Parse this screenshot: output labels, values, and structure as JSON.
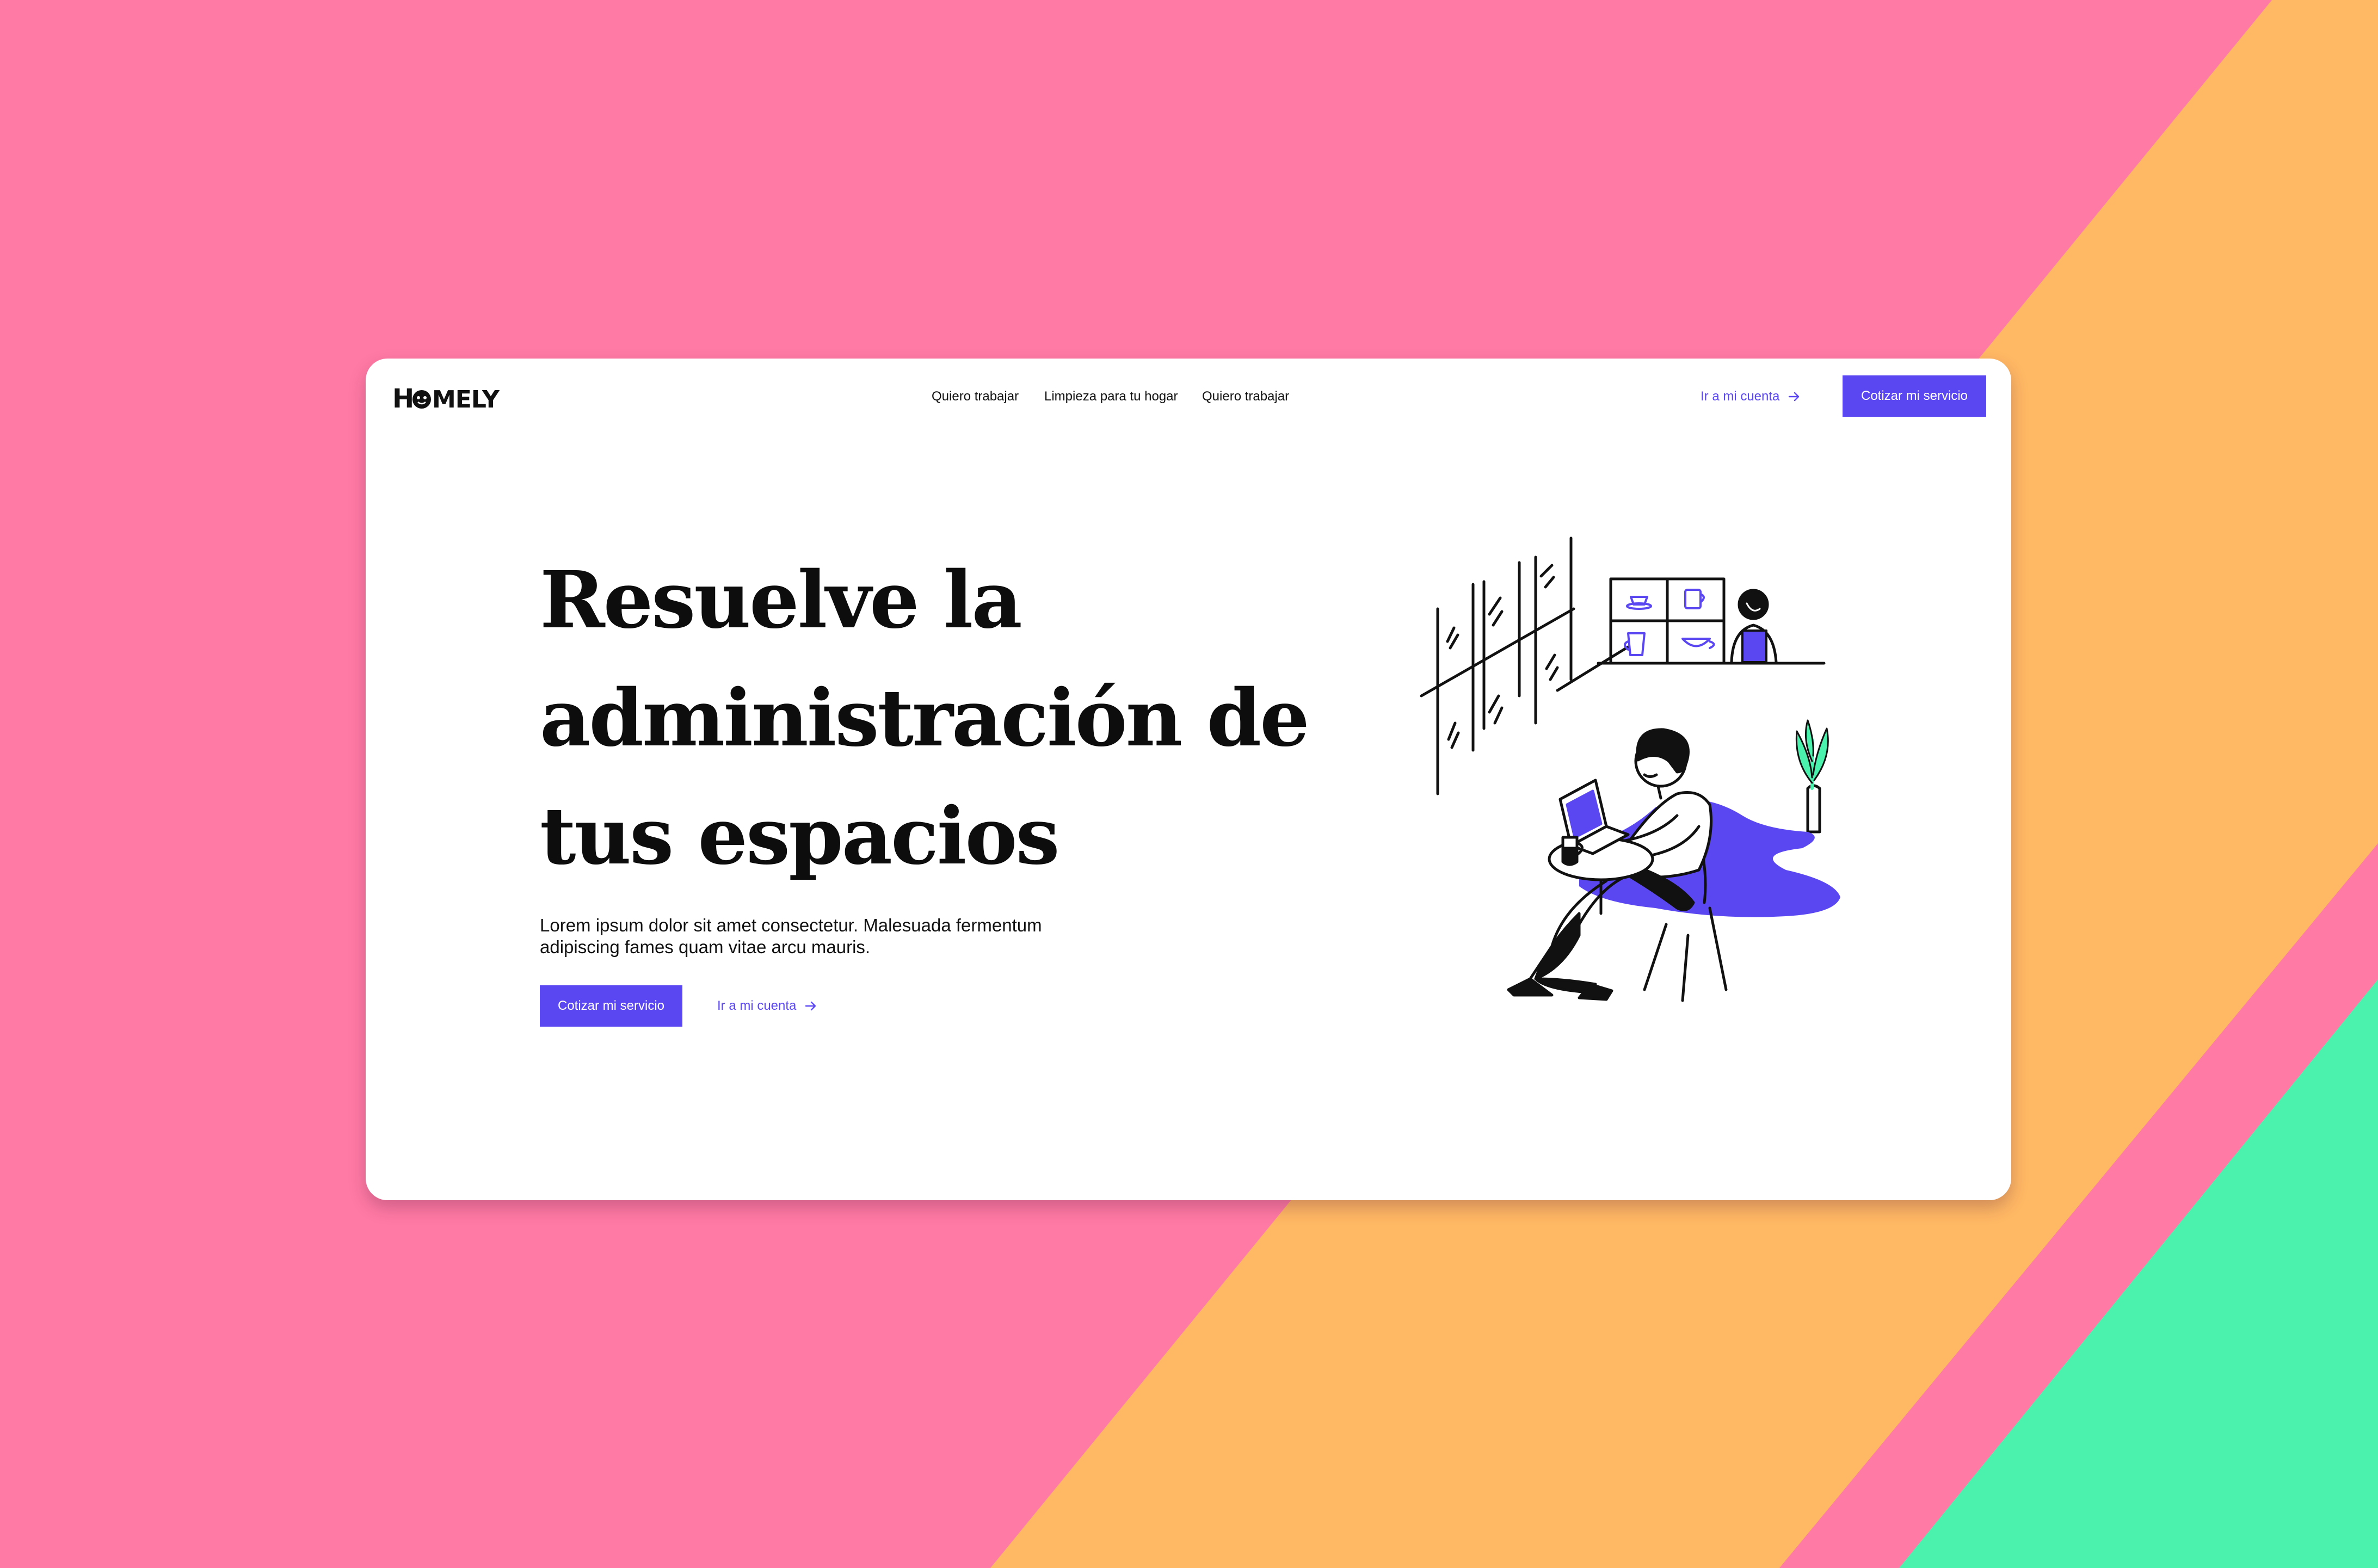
{
  "colors": {
    "pink": "#ff7aa5",
    "orange": "#ffb864",
    "green": "#4bf2ad",
    "accent": "#5b47f2",
    "card": "#ffffff",
    "text": "#0d0d0d"
  },
  "brand": {
    "logo_text": "HOMELY"
  },
  "nav": {
    "links": [
      {
        "label": "Quiero trabajar"
      },
      {
        "label": "Limpieza para tu hogar"
      },
      {
        "label": "Quiero trabajar"
      }
    ],
    "account_link": "Ir a mi cuenta",
    "account_icon": "arrow-right-icon",
    "cta": "Cotizar mi servicio"
  },
  "hero": {
    "title_lines": [
      "Resuelve la",
      "administración de",
      "tus espacios"
    ],
    "subtitle_lines": [
      "Lorem ipsum dolor sit amet consectetur. Malesuada fermentum",
      "adipiscing fames quam vitae arcu mauris."
    ],
    "cta": "Cotizar mi servicio",
    "account_link": "Ir a mi cuenta"
  },
  "illustration": {
    "icon": "person-working-laptop-cafe-illustration"
  }
}
